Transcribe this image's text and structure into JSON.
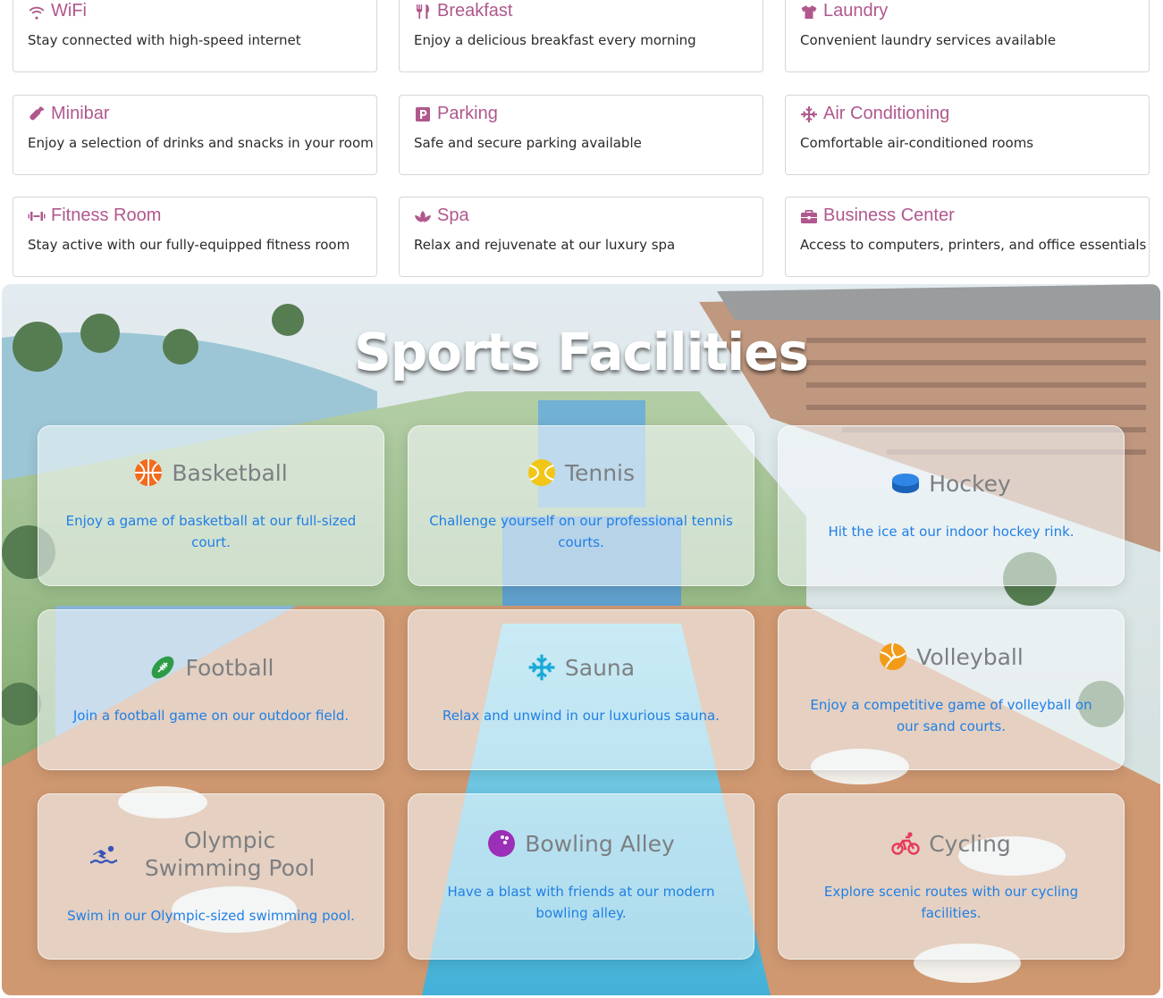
{
  "amenities": [
    {
      "title": "WiFi",
      "desc": "Stay connected with high-speed internet",
      "icon": "wifi-icon"
    },
    {
      "title": "Breakfast",
      "desc": "Enjoy a delicious breakfast every morning",
      "icon": "utensils-icon"
    },
    {
      "title": "Laundry",
      "desc": "Convenient laundry services available",
      "icon": "shirt-icon"
    },
    {
      "title": "Minibar",
      "desc": "Enjoy a selection of drinks and snacks in your room",
      "icon": "bottle-icon"
    },
    {
      "title": "Parking",
      "desc": "Safe and secure parking available",
      "icon": "parking-icon"
    },
    {
      "title": "Air Conditioning",
      "desc": "Comfortable air-conditioned rooms",
      "icon": "snowflake-icon"
    },
    {
      "title": "Fitness Room",
      "desc": "Stay active with our fully-equipped fitness room",
      "icon": "dumbbell-icon"
    },
    {
      "title": "Spa",
      "desc": "Relax and rejuvenate at our luxury spa",
      "icon": "lotus-icon"
    },
    {
      "title": "Business Center",
      "desc": "Access to computers, printers, and office essentials",
      "icon": "briefcase-icon"
    }
  ],
  "sports": {
    "title": "Sports Facilities",
    "cards": [
      {
        "name": "Basketball",
        "desc": "Enjoy a game of basketball at our full-sized court.",
        "icon": "basketball-icon",
        "color": "#f26b1d"
      },
      {
        "name": "Tennis",
        "desc": "Challenge yourself on our professional tennis courts.",
        "icon": "tennis-ball-icon",
        "color": "#f2c618"
      },
      {
        "name": "Hockey",
        "desc": "Hit the ice at our indoor hockey rink.",
        "icon": "hockey-puck-icon",
        "color": "#1e78d8"
      },
      {
        "name": "Football",
        "desc": "Join a football game on our outdoor field.",
        "icon": "football-icon",
        "color": "#2e9b46"
      },
      {
        "name": "Sauna",
        "desc": "Relax and unwind in our luxurious sauna.",
        "icon": "snowflake-icon",
        "color": "#18a9d8"
      },
      {
        "name": "Volleyball",
        "desc": "Enjoy a competitive game of volleyball on our sand courts.",
        "icon": "volleyball-icon",
        "color": "#f29b18"
      },
      {
        "name": "Olympic Swimming Pool",
        "desc": "Swim in our Olympic-sized swimming pool.",
        "icon": "swimmer-icon",
        "color": "#3a52b8"
      },
      {
        "name": "Bowling Alley",
        "desc": "Have a blast with friends at our modern bowling alley.",
        "icon": "bowling-ball-icon",
        "color": "#9b2fb8"
      },
      {
        "name": "Cycling",
        "desc": "Explore scenic routes with our cycling facilities.",
        "icon": "bicycle-icon",
        "color": "#e63b5a"
      }
    ]
  }
}
